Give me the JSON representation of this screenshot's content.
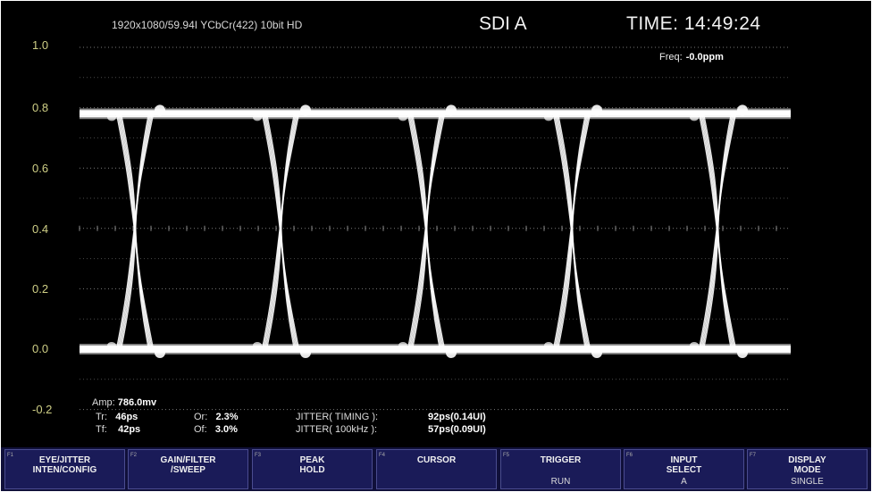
{
  "header": {
    "format": "1920x1080/59.94I YCbCr(422) 10bit HD",
    "input_name": "SDI A",
    "time": "TIME: 14:49:24",
    "freq_label": "Freq:",
    "freq_value": "-0.0ppm"
  },
  "y_axis_labels": [
    "1.0",
    "0.8",
    "0.6",
    "0.4",
    "0.2",
    "0.0",
    "-0.2"
  ],
  "chart_data": {
    "type": "line",
    "title": "",
    "y_ticks": [
      1.0,
      0.8,
      0.6,
      0.4,
      0.2,
      0.0,
      -0.2
    ],
    "ylim": [
      -0.2,
      1.0
    ],
    "high_level": 0.78,
    "low_level": 0.0,
    "crossing_level": 0.4,
    "crossings": 5,
    "grid": true
  },
  "measurements": {
    "amp_label": "Amp:",
    "amp_value": "786.0mv",
    "tr_label": "Tr:",
    "tr_value": "46ps",
    "tf_label": "Tf:",
    "tf_value": "42ps",
    "or_label": "Or:",
    "or_value": "2.3%",
    "of_label": "Of:",
    "of_value": "3.0%",
    "jitter_timing_label": "JITTER( TIMING ):",
    "jitter_timing_value": "92ps(0.14UI)",
    "jitter_100k_label": "JITTER( 100kHz ):",
    "jitter_100k_value": "57ps(0.09UI)"
  },
  "function_keys": [
    {
      "num": "F1",
      "label": "EYE/JITTER\nINTEN/CONFIG",
      "value": ""
    },
    {
      "num": "F2",
      "label": "GAIN/FILTER\n/SWEEP",
      "value": ""
    },
    {
      "num": "F3",
      "label": "PEAK\nHOLD",
      "value": ""
    },
    {
      "num": "F4",
      "label": "CURSOR",
      "value": ""
    },
    {
      "num": "F5",
      "label": "TRIGGER",
      "value": "RUN"
    },
    {
      "num": "F6",
      "label": "INPUT\nSELECT",
      "value": "A"
    },
    {
      "num": "F7",
      "label": "DISPLAY\nMODE",
      "value": "SINGLE"
    }
  ],
  "colors": {
    "background": "#000000",
    "trace": "#ffffff",
    "axis_label": "#cfcf86",
    "menu_key": "#1a1b58"
  }
}
